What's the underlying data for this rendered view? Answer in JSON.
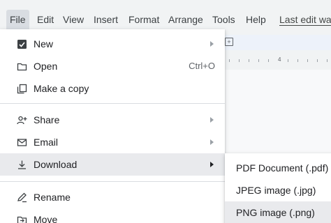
{
  "menubar": {
    "items": [
      "File",
      "Edit",
      "View",
      "Insert",
      "Format",
      "Arrange",
      "Tools",
      "Help"
    ],
    "last_edit": "Last edit wa"
  },
  "ruler": {
    "mark": "4"
  },
  "file_menu": {
    "new": "New",
    "open": "Open",
    "open_shortcut": "Ctrl+O",
    "make_copy": "Make a copy",
    "share": "Share",
    "email": "Email",
    "download": "Download",
    "rename": "Rename",
    "move": "Move"
  },
  "download_menu": {
    "pdf": "PDF Document (.pdf)",
    "jpeg": "JPEG image (.jpg)",
    "png": "PNG image (.png)"
  },
  "colors": {
    "menu_highlight": "#e9eaed",
    "menubar_bg": "#f1f3f4"
  }
}
